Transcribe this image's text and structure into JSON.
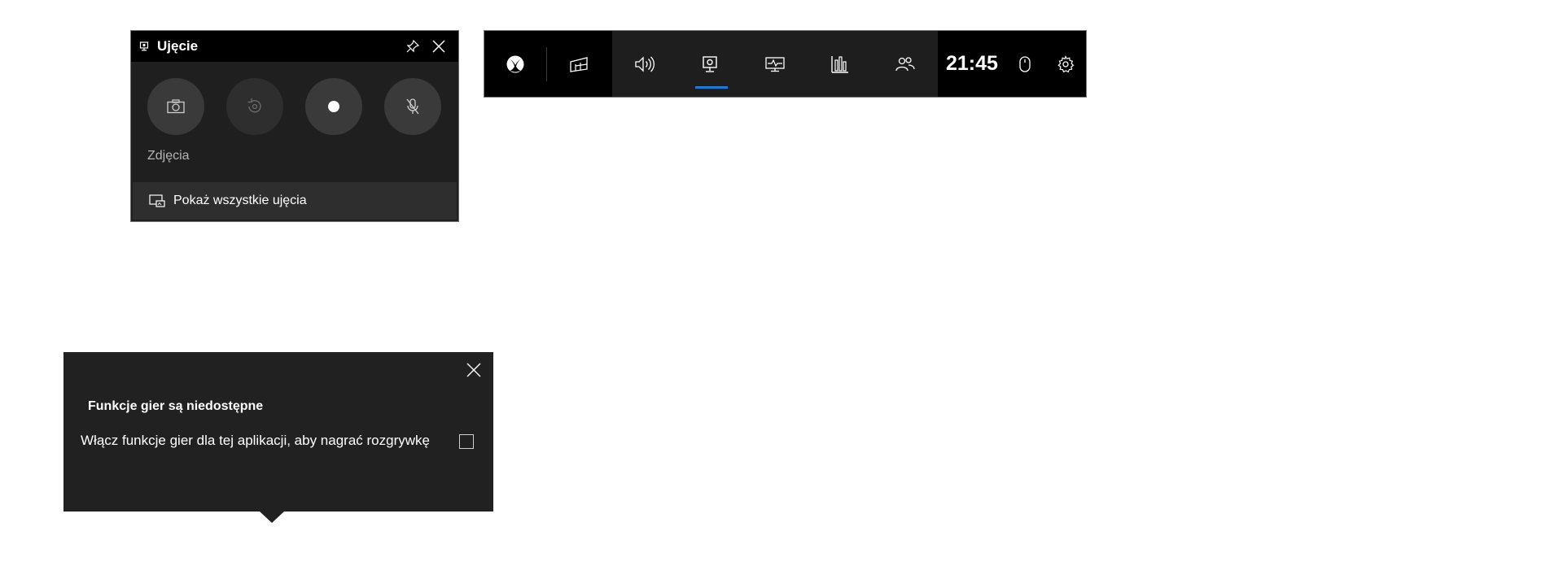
{
  "capture": {
    "title": "Ujęcie",
    "section_label": "Zdjęcia",
    "show_all_label": "Pokaż wszystkie ujęcia",
    "buttons": [
      {
        "icon": "camera-icon",
        "enabled": true
      },
      {
        "icon": "replay-icon",
        "enabled": false
      },
      {
        "icon": "record-icon",
        "enabled": true
      },
      {
        "icon": "mic-off-icon",
        "enabled": true
      }
    ]
  },
  "gamebar": {
    "time": "21:45",
    "accent": "#1c7ad6",
    "icons": [
      "xbox-icon",
      "widget-menu-icon",
      "audio-icon",
      "capture-icon",
      "performance-icon",
      "resources-icon",
      "social-icon",
      "mouse-icon",
      "gear-icon"
    ],
    "active": "capture-icon"
  },
  "notice": {
    "title": "Funkcje gier są niedostępne",
    "text": "Włącz funkcje gier dla tej aplikacji, aby nagrać rozgrywkę",
    "checked": false
  }
}
